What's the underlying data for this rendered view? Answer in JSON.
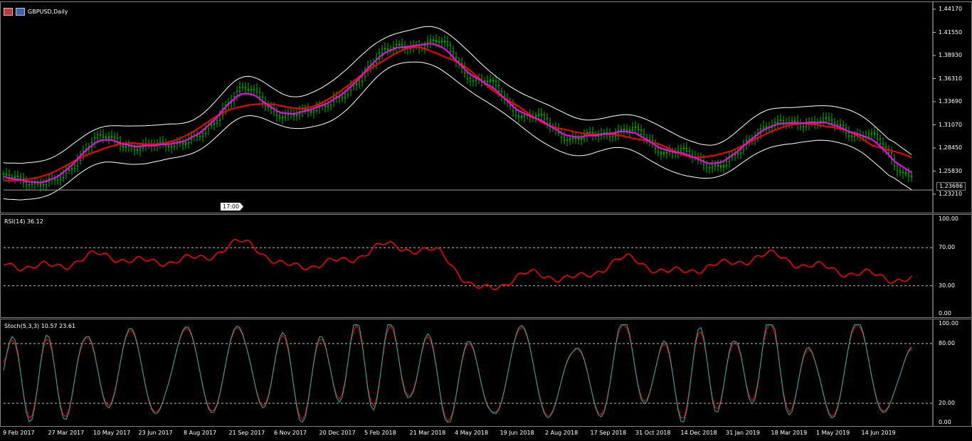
{
  "symbol": {
    "title": "GBPUSD,Daily"
  },
  "price_scale": [
    "1.44170",
    "1.41550",
    "1.38930",
    "1.36310",
    "1.33690",
    "1.31070",
    "1.28450",
    "1.25830",
    "1.23210"
  ],
  "current_price": "1.23686",
  "time_badge": "17:00",
  "rsi": {
    "label": "RSI(14) 36.12",
    "scale": [
      "100.00",
      "70.00",
      "30.00",
      "0.00"
    ]
  },
  "stoch": {
    "label": "Stoch(5,3,3) 10.57 23.61",
    "scale": [
      "100.00",
      "80.00",
      "20.00",
      "0.00"
    ]
  },
  "x_axis": [
    "9 Feb 2017",
    "27 Mar 2017",
    "10 May 2017",
    "23 Jun 2017",
    "8 Aug 2017",
    "21 Sep 2017",
    "6 Nov 2017",
    "20 Dec 2017",
    "5 Feb 2018",
    "21 Mar 2018",
    "4 May 2018",
    "19 Jun 2018",
    "2 Aug 2018",
    "17 Sep 2018",
    "31 Oct 2018",
    "14 Dec 2018",
    "31 Jan 2019",
    "18 Mar 2019",
    "1 May 2019",
    "14 Jun 2019"
  ],
  "colors": {
    "candles": "#00c000",
    "ma_fast": "#ff00ff",
    "ma_slow": "#ff0000",
    "bands": "#ffffff",
    "rsi": "#ff0000",
    "stoch_main": "#20b2aa",
    "stoch_signal": "#ff0000"
  },
  "chart_data": {
    "type": "line",
    "title": "GBPUSD,Daily",
    "ylim": [
      1.2321,
      1.4417
    ],
    "x": [
      "9 Feb 2017",
      "27 Mar 2017",
      "10 May 2017",
      "23 Jun 2017",
      "8 Aug 2017",
      "21 Sep 2017",
      "6 Nov 2017",
      "20 Dec 2017",
      "5 Feb 2018",
      "21 Mar 2018",
      "4 May 2018",
      "19 Jun 2018",
      "2 Aug 2018",
      "17 Sep 2018",
      "31 Oct 2018",
      "14 Dec 2018",
      "31 Jan 2019",
      "18 Mar 2019",
      "1 May 2019",
      "14 Jun 2019"
    ],
    "series": [
      {
        "name": "close",
        "values": [
          1.25,
          1.245,
          1.295,
          1.285,
          1.295,
          1.35,
          1.32,
          1.34,
          1.395,
          1.405,
          1.36,
          1.32,
          1.295,
          1.305,
          1.28,
          1.265,
          1.31,
          1.315,
          1.3,
          1.255
        ]
      },
      {
        "name": "rsi",
        "values": [
          52,
          50,
          62,
          55,
          58,
          75,
          50,
          55,
          72,
          66,
          26,
          42,
          38,
          58,
          44,
          52,
          62,
          50,
          42,
          36
        ]
      },
      {
        "name": "stoch",
        "values": [
          60,
          20,
          85,
          30,
          70,
          90,
          25,
          75,
          88,
          45,
          10,
          60,
          30,
          85,
          35,
          55,
          92,
          20,
          70,
          11
        ]
      }
    ]
  }
}
